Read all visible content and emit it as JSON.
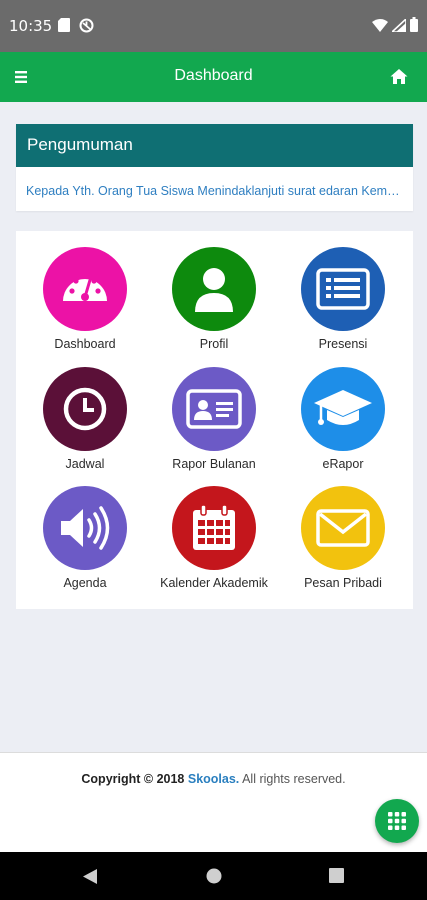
{
  "status_bar": {
    "time": "10:35"
  },
  "app_bar": {
    "title": "Dashboard",
    "menu_icon": "hamburger-icon",
    "home_icon": "home-icon",
    "background": "#12a84f"
  },
  "announcement": {
    "title": "Pengumuman",
    "text": "Kepada Yth. Orang Tua Siswa Menindaklanjuti surat edaran Kemdikbud",
    "header_color": "#0f6f73",
    "link_color": "#2f7fc1"
  },
  "menu": {
    "items": [
      {
        "label": "Dashboard",
        "icon": "speedometer-icon",
        "color": "#ec12a6"
      },
      {
        "label": "Profil",
        "icon": "user-icon",
        "color": "#0d8a0d"
      },
      {
        "label": "Presensi",
        "icon": "list-icon",
        "color": "#1e5fb4"
      },
      {
        "label": "Jadwal",
        "icon": "clock-icon",
        "color": "#5b1038"
      },
      {
        "label": "Rapor Bulanan",
        "icon": "id-card-icon",
        "color": "#6c5ac6"
      },
      {
        "label": "eRapor",
        "icon": "graduation-cap-icon",
        "color": "#1e8ee8"
      },
      {
        "label": "Agenda",
        "icon": "volume-icon",
        "color": "#6c5ac6"
      },
      {
        "label": "Kalender Akademik",
        "icon": "calendar-icon",
        "color": "#c4161c"
      },
      {
        "label": "Pesan Pribadi",
        "icon": "envelope-icon",
        "color": "#f2c20e"
      }
    ]
  },
  "footer": {
    "copyright": "Copyright © 2018",
    "brand": "Skoolas.",
    "rights": "All rights reserved."
  },
  "fab": {
    "icon": "grid-icon"
  }
}
